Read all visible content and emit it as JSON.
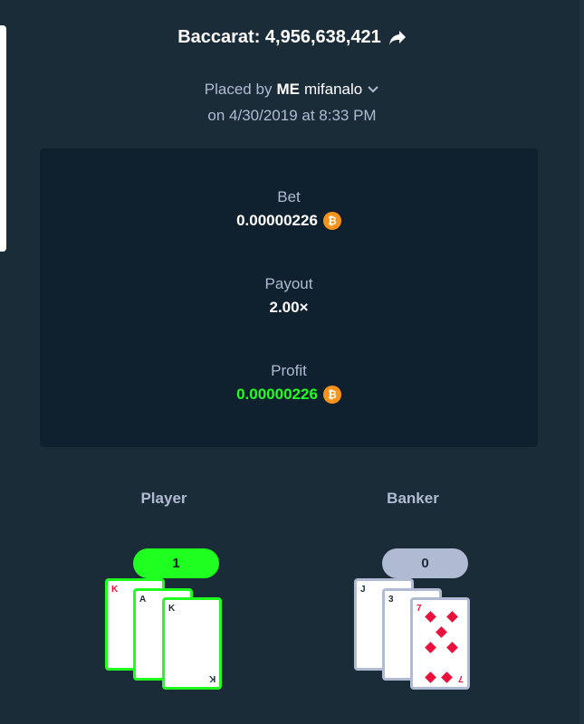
{
  "header": {
    "title": "Baccarat: 4,956,638,421",
    "placed_by_prefix": "Placed by",
    "placed_by_me": "ME",
    "placed_by_user": "mifanalo",
    "date_line": "on 4/30/2019 at 8:33 PM"
  },
  "stats": {
    "bet_label": "Bet",
    "bet_value": "0.00000226",
    "payout_label": "Payout",
    "payout_value": "2.00×",
    "profit_label": "Profit",
    "profit_value": "0.00000226",
    "currency_icon": "bitcoin-icon",
    "currency_symbol": "₿"
  },
  "player": {
    "label": "Player",
    "score": "1",
    "cards": [
      {
        "rank": "K",
        "suit": "spades"
      },
      {
        "rank": "A",
        "suit": "spades"
      },
      {
        "rank": "K",
        "suit": "spades",
        "center": "♠"
      }
    ]
  },
  "banker": {
    "label": "Banker",
    "score": "0",
    "cards": [
      {
        "rank": "J",
        "suit": "spades"
      },
      {
        "rank": "3",
        "suit": "spades"
      },
      {
        "rank": "7",
        "suit": "diamonds"
      }
    ]
  },
  "colors": {
    "background": "#1a2c38",
    "panel": "#0f212e",
    "win_green": "#1fff20",
    "muted_text": "#b1bad3",
    "bitcoin": "#f7931a",
    "card_red": "#e9113c"
  }
}
